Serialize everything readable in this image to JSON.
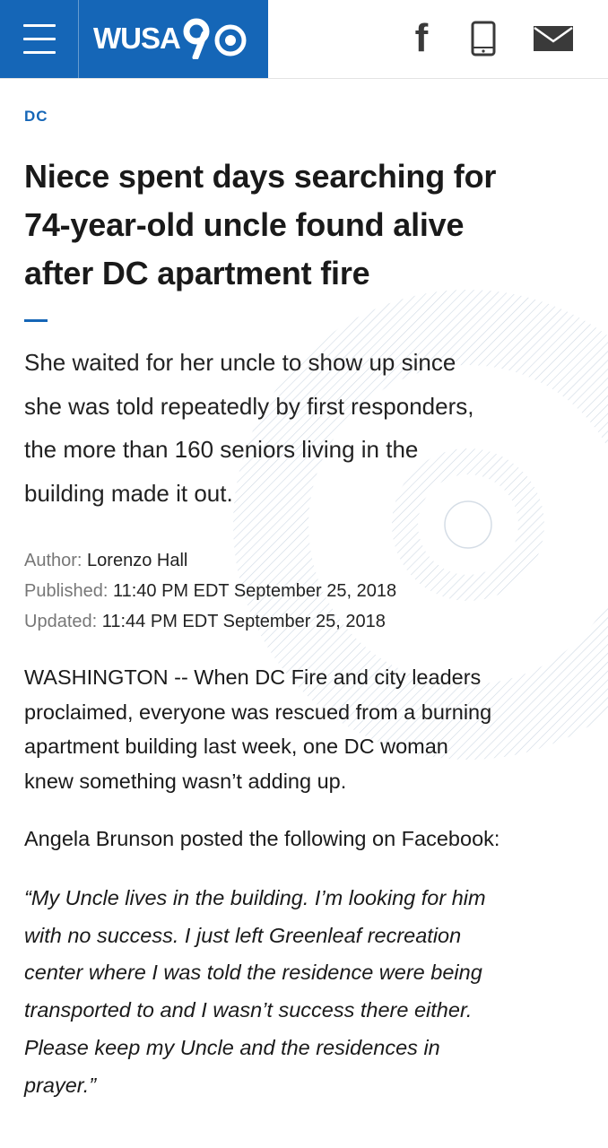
{
  "header": {
    "logo_text": "WUSA",
    "icons": [
      "menu-icon",
      "facebook-icon",
      "phone-icon",
      "mail-icon"
    ],
    "brand_color": "#1566b7",
    "facebook_glyph": "f"
  },
  "article": {
    "category": "DC",
    "headline_lines": [
      "Niece spent days searching for",
      "74-year-old uncle found alive",
      "after DC apartment fire"
    ],
    "summary_lines": [
      "She waited for her uncle to show up since",
      "she was told repeatedly by first responders,",
      "the more than 160 seniors living in the",
      "building made it out."
    ],
    "author_label": "Author:",
    "author": "Lorenzo Hall",
    "published_label": "Published:",
    "published": "11:40 PM EDT September 25, 2018",
    "updated_label": "Updated:",
    "updated": "11:44 PM EDT September 25, 2018",
    "para1_lines": [
      "WASHINGTON -- When DC Fire and city leaders",
      "proclaimed, everyone was rescued from a burning",
      "apartment building last week, one DC woman",
      "knew something wasn’t adding up."
    ],
    "para2": "Angela Brunson posted the following on Facebook:",
    "quote_lines": [
      "“My Uncle lives in the building. I’m looking for him",
      "with no success. I just left Greenleaf recreation",
      "center where I was told the residence were being",
      "transported to and I wasn’t success there either.",
      "Please keep my Uncle and the residences in",
      "prayer.”"
    ]
  }
}
